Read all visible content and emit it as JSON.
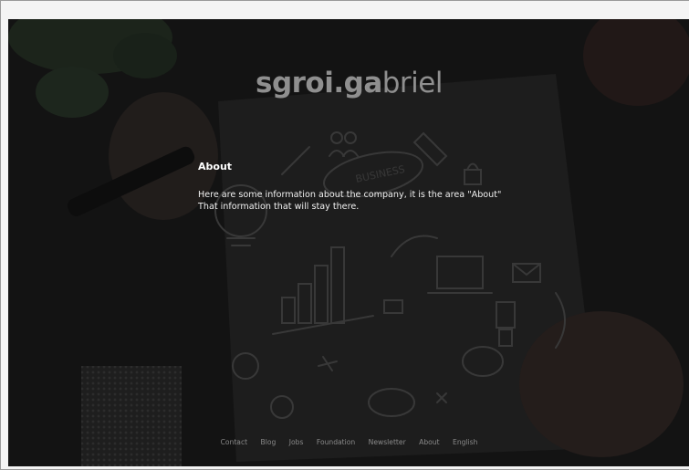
{
  "brand": {
    "logo_bold": "sgroi.ga",
    "logo_light": "briel"
  },
  "about": {
    "heading": "About",
    "line1": "Here are some information about the company, it is the area \"About\"",
    "line2": "That information that will stay there."
  },
  "footer": {
    "links": [
      "Contact",
      "Blog",
      "Jobs",
      "Foundation",
      "Newsletter",
      "About",
      "English"
    ]
  },
  "background": {
    "description_icon": "business-doodle-sketch",
    "sketch_label": "BUSINESS"
  }
}
